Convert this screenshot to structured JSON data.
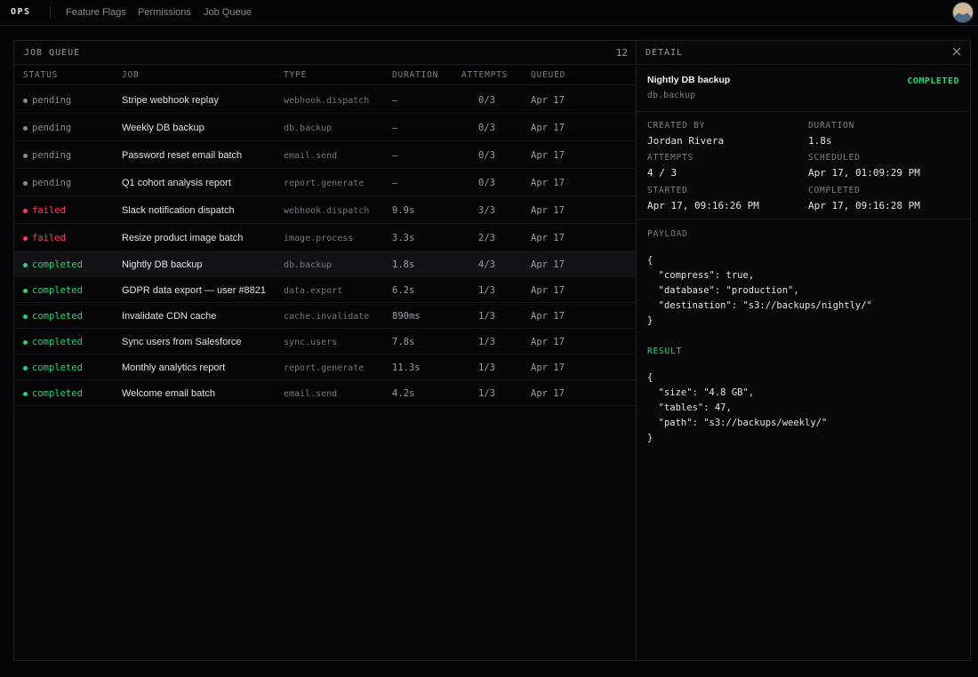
{
  "app": {
    "brand": "OPS"
  },
  "nav": {
    "items": [
      "Feature Flags",
      "Permissions",
      "Job Queue"
    ]
  },
  "colors": {
    "pending": "#8a8a92",
    "failed": "#ff3b5c",
    "completed": "#22d67a",
    "accent": "#22d67a"
  },
  "queue": {
    "title": "JOB QUEUE",
    "count": "12",
    "columns": [
      "STATUS",
      "JOB",
      "TYPE",
      "DURATION",
      "ATTEMPTS",
      "QUEUED"
    ],
    "rows": [
      {
        "status": "pending",
        "job": "Stripe webhook replay",
        "type": "webhook.dispatch",
        "duration": "—",
        "attempts": "0/3",
        "queued": "Apr 17"
      },
      {
        "status": "pending",
        "job": "Weekly DB backup",
        "type": "db.backup",
        "duration": "—",
        "attempts": "0/3",
        "queued": "Apr 17"
      },
      {
        "status": "pending",
        "job": "Password reset email batch",
        "type": "email.send",
        "duration": "—",
        "attempts": "0/3",
        "queued": "Apr 17"
      },
      {
        "status": "pending",
        "job": "Q1 cohort analysis report",
        "type": "report.generate",
        "duration": "—",
        "attempts": "0/3",
        "queued": "Apr 17"
      },
      {
        "status": "failed",
        "job": "Slack notification dispatch",
        "type": "webhook.dispatch",
        "duration": "9.9s",
        "attempts": "3/3",
        "queued": "Apr 17"
      },
      {
        "status": "failed",
        "job": "Resize product image batch",
        "type": "image.process",
        "duration": "3.3s",
        "attempts": "2/3",
        "queued": "Apr 17"
      },
      {
        "status": "completed",
        "job": "Nightly DB backup",
        "type": "db.backup",
        "duration": "1.8s",
        "attempts": "4/3",
        "queued": "Apr 17",
        "selected": true
      },
      {
        "status": "completed",
        "job": "GDPR data export — user #8821",
        "type": "data.export",
        "duration": "6.2s",
        "attempts": "1/3",
        "queued": "Apr 17"
      },
      {
        "status": "completed",
        "job": "Invalidate CDN cache",
        "type": "cache.invalidate",
        "duration": "890ms",
        "attempts": "1/3",
        "queued": "Apr 17"
      },
      {
        "status": "completed",
        "job": "Sync users from Salesforce",
        "type": "sync.users",
        "duration": "7.8s",
        "attempts": "1/3",
        "queued": "Apr 17"
      },
      {
        "status": "completed",
        "job": "Monthly analytics report",
        "type": "report.generate",
        "duration": "11.3s",
        "attempts": "1/3",
        "queued": "Apr 17"
      },
      {
        "status": "completed",
        "job": "Welcome email batch",
        "type": "email.send",
        "duration": "4.2s",
        "attempts": "1/3",
        "queued": "Apr 17"
      }
    ]
  },
  "detail": {
    "title": "DETAIL",
    "job_name": "Nightly DB backup",
    "job_type": "db.backup",
    "status": "COMPLETED",
    "created_by_label": "CREATED BY",
    "created_by": "Jordan Rivera",
    "duration_label": "DURATION",
    "duration": "1.8s",
    "attempts_label": "ATTEMPTS",
    "attempts": "4 / 3",
    "scheduled_label": "SCHEDULED",
    "scheduled": "Apr 17, 01:09:29 PM",
    "started_label": "STARTED",
    "started": "Apr 17, 09:16:26 PM",
    "completed_label": "COMPLETED",
    "completed": "Apr 17, 09:16:28 PM",
    "payload_label": "PAYLOAD",
    "payload": "{\n  \"compress\": true,\n  \"database\": \"production\",\n  \"destination\": \"s3://backups/nightly/\"\n}",
    "result_label": "RESULT",
    "result": "{\n  \"size\": \"4.8 GB\",\n  \"tables\": 47,\n  \"path\": \"s3://backups/weekly/\"\n}"
  }
}
